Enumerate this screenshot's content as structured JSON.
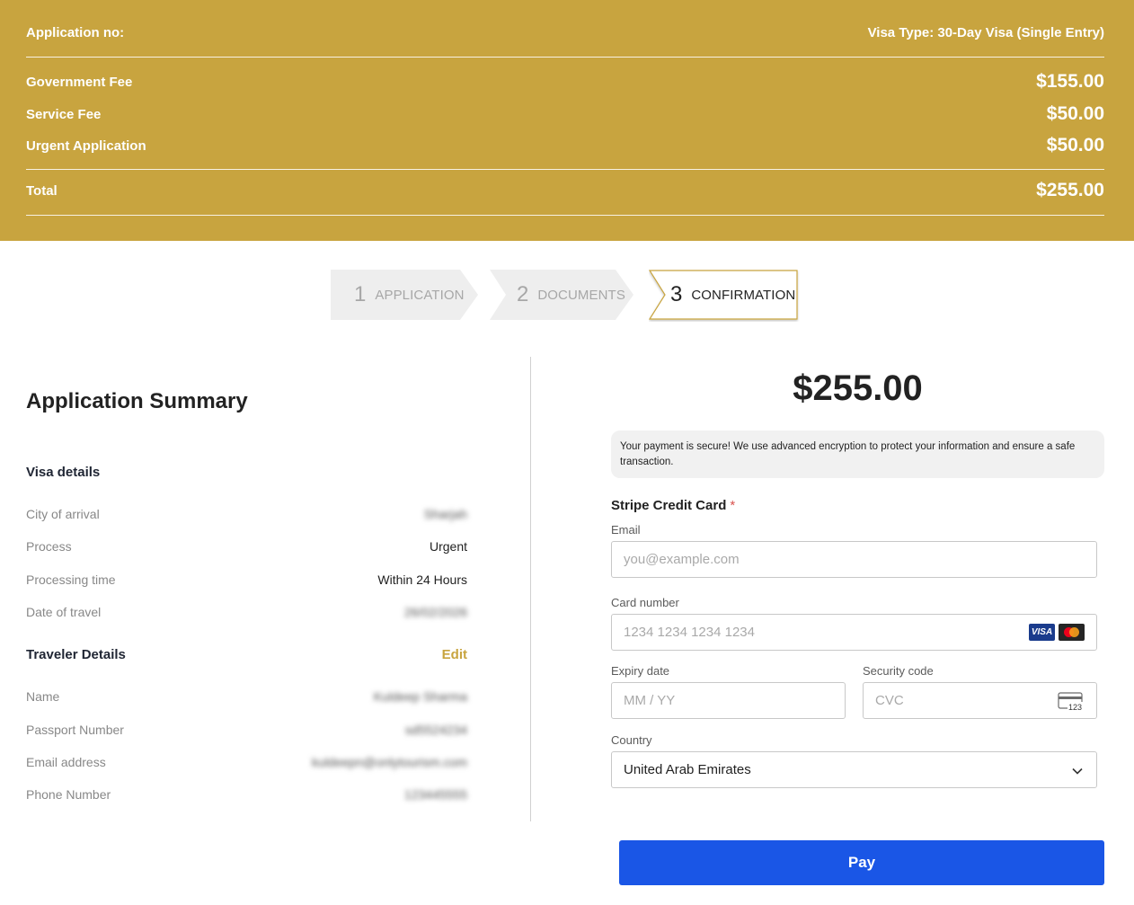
{
  "fees": {
    "application_no_label": "Application no:",
    "visa_type": "Visa Type: 30-Day Visa (Single Entry)",
    "items": [
      {
        "label": "Government Fee",
        "amount": "$155.00"
      },
      {
        "label": "Service Fee",
        "amount": "$50.00"
      },
      {
        "label": "Urgent Application",
        "amount": "$50.00"
      }
    ],
    "total_label": "Total",
    "total_amount": "$255.00"
  },
  "steps": [
    {
      "number": "1",
      "label": "APPLICATION",
      "active": false
    },
    {
      "number": "2",
      "label": "DOCUMENTS",
      "active": false
    },
    {
      "number": "3",
      "label": "CONFIRMATION",
      "active": true
    }
  ],
  "summary": {
    "title": "Application Summary",
    "visa_details_title": "Visa details",
    "visa_details": [
      {
        "label": "City of arrival",
        "value": "Sharjah",
        "blurred": true
      },
      {
        "label": "Process",
        "value": "Urgent",
        "blurred": false
      },
      {
        "label": "Processing time",
        "value": "Within 24 Hours",
        "blurred": false
      },
      {
        "label": "Date of travel",
        "value": "26/02/2026",
        "blurred": true
      }
    ],
    "traveler_title": "Traveler Details",
    "edit_label": "Edit",
    "traveler_details": [
      {
        "label": "Name",
        "value": "Kuldeep Sharma",
        "blurred": true
      },
      {
        "label": "Passport Number",
        "value": "sd5524234",
        "blurred": true
      },
      {
        "label": "Email address",
        "value": "kuldeepn@onlytourism.com",
        "blurred": true
      },
      {
        "label": "Phone Number",
        "value": "123445555",
        "blurred": true
      }
    ]
  },
  "payment": {
    "amount": "$255.00",
    "secure_note": "Your payment is secure! We use advanced encryption to protect your information and ensure a safe transaction.",
    "method_title": "Stripe Credit Card",
    "required_mark": "*",
    "email_label": "Email",
    "email_placeholder": "you@example.com",
    "card_label": "Card number",
    "card_placeholder": "1234 1234 1234 1234",
    "visa_logo_text": "VISA",
    "expiry_label": "Expiry date",
    "expiry_placeholder": "MM / YY",
    "cvc_label": "Security code",
    "cvc_placeholder": "CVC",
    "cvc_icon_text": "123",
    "country_label": "Country",
    "country_value": "United Arab Emirates",
    "pay_label": "Pay"
  },
  "colors": {
    "banner": "#c8a43f",
    "pay_button": "#1a56e6",
    "edit_link": "#c8a43f"
  }
}
